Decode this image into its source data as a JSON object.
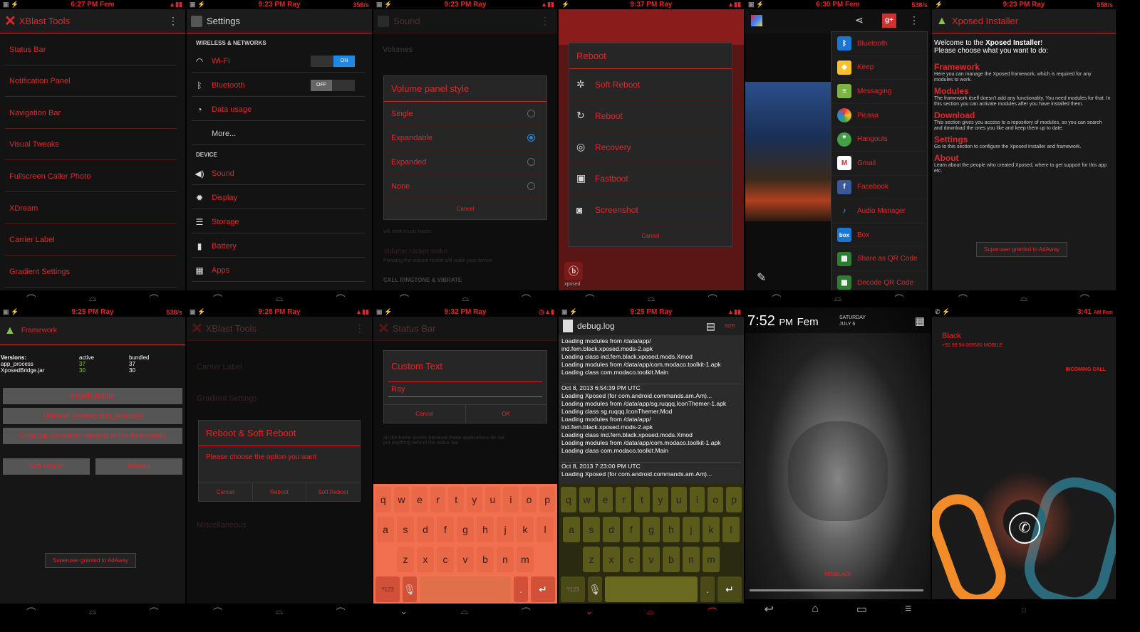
{
  "colors": {
    "accent": "#e0272b",
    "blue": "#1e88e5"
  },
  "p1": {
    "time": "6:27 PM Fem",
    "title": "XBlast Tools",
    "items": [
      "Status Bar",
      "Notification Panel",
      "Navigation Bar",
      "Visual Tweaks",
      "Fullscreen Caller Photo",
      "XDream",
      "Carrier Label",
      "Gradient Settings"
    ]
  },
  "p2": {
    "time": "9:23 PM Ray",
    "net": "358/s",
    "title": "Settings",
    "head1": "WIRELESS & NETWORKS",
    "wifi": "Wi-Fi",
    "wifi_state": "ON",
    "bt": "Bluetooth",
    "bt_state": "OFF",
    "data": "Data usage",
    "more": "More...",
    "head2": "DEVICE",
    "sound": "Sound",
    "display": "Display",
    "storage": "Storage",
    "battery": "Battery",
    "apps": "Apps"
  },
  "p3": {
    "time": "9:23 PM Ray",
    "title": "Sound",
    "bg1": "Volumes",
    "dlg_title": "Volume panel style",
    "options": [
      "Single",
      "Expandable",
      "Expanded",
      "None"
    ],
    "cancel": "Cancel",
    "bg2": "will seek music tracks",
    "bg3": "Volume rocker wake",
    "bg4": "Pressing the volume rocker will wake your device",
    "bg5": "CALL RINGTONE & VIBRATE"
  },
  "p4": {
    "time": "9:37 PM Ray",
    "title": "Reboot",
    "options": [
      "Soft Reboot",
      "Reboot",
      "Recovery",
      "Fastboot",
      "Screenshot"
    ],
    "cancel": "Cancel",
    "app": "xposed"
  },
  "p5": {
    "time": "6:30 PM Fem",
    "net": "538/s",
    "apps": [
      "Bluetooth",
      "Keep",
      "Messaging",
      "Picasa",
      "Hangouts",
      "Gmail",
      "Facebook",
      "Audio Manager",
      "Box",
      "Share as QR Code",
      "Decode QR Code"
    ]
  },
  "p6": {
    "time": "9:23 PM Ray",
    "net": "558/s",
    "title": "Xposed Installer",
    "welcome1": "Welcome to the ",
    "welcome_b": "Xposed Installer",
    "welcome2": "!",
    "welcome3": "Please choose what you want to do:",
    "sections": [
      {
        "h": "Framework",
        "p": "Here you can manage the Xposed framework, which is required for any modules to work."
      },
      {
        "h": "Modules",
        "p": "The framework itself doesn't add any functionality. You need modules for that. In this section you can activate modules after you have installed them."
      },
      {
        "h": "Download",
        "p": "This section gives you access to a repository of modules, so you can search and download the ones you like and keep them up to date."
      },
      {
        "h": "Settings",
        "p": "Go to this section to configure the Xposed Installer and framework."
      },
      {
        "h": "About",
        "p": "Learn about the people who created Xposed, where to get support for this app etc."
      }
    ],
    "toast": "Superuser granted to AdAway"
  },
  "p7": {
    "time": "9:25 PM Ray",
    "net": "538/s",
    "title": "Framework",
    "versions": "Versions:",
    "active": "active",
    "bundled": "bundled",
    "rows": [
      {
        "n": "app_process",
        "a": "37",
        "b": "37"
      },
      {
        "n": "XposedBridge.jar",
        "a": "30",
        "b": "30"
      }
    ],
    "install": "Install/Update",
    "uninstall": "Uninstall (restore app_process)",
    "cleanup": "Clean up (complete removal of the framework)",
    "soft": "Soft reboot",
    "reboot": "Reboot",
    "toast": "Superuser granted to AdAway"
  },
  "p8": {
    "time": "9:28 PM Ray",
    "title": "XBlast Tools",
    "bg1": "Carrier Label",
    "bg2": "Gradient Settings",
    "dlg_title": "Reboot & Soft Reboot",
    "msg": "Please choose the option you want",
    "btns": [
      "Cancel",
      "Reboot",
      "Soft Reboot"
    ],
    "bg3": "Miscellaneous"
  },
  "p9": {
    "time": "9:32 PM Ray",
    "title": "Status Bar",
    "dlg_title": "Custom Text",
    "value": "Ray",
    "cancel": "Cancel",
    "ok": "OK",
    "bg": "on the home screen because these applications do not put anything behind the status bar",
    "row1": [
      "q",
      "w",
      "e",
      "r",
      "t",
      "y",
      "u",
      "i",
      "o",
      "p"
    ],
    "row2": [
      "a",
      "s",
      "d",
      "f",
      "g",
      "h",
      "j",
      "k",
      "l"
    ],
    "row3": [
      "z",
      "x",
      "c",
      "v",
      "b",
      "n",
      "m"
    ],
    "sym": "?123"
  },
  "p10": {
    "time": "9:25 PM Ray",
    "title": "debug.log",
    "size": "SIZE",
    "lines": [
      "Loading modules from /data/app/",
      "ind.fem.black.xposed.mods-2.apk",
      "  Loading class ind.fem.black.xposed.mods.Xmod",
      "Loading modules from /data/app/com.modaco.toolkit-1.apk",
      "  Loading class com.modaco.toolkit.Main",
      "",
      "Oct 8, 2013 6:54:39 PM UTC",
      "Loading Xposed (for com.android.commands.am.Am)...",
      "Loading modules from /data/app/sg.ruqqq.IconThemer-1.apk",
      "  Loading class sg.ruqqq.IconThemer.Mod",
      "Loading modules from /data/app/",
      "ind.fem.black.xposed.mods-2.apk",
      "  Loading class ind.fem.black.xposed.mods.Xmod",
      "Loading modules from /data/app/com.modaco.toolkit-1.apk",
      "  Loading class com.modaco.toolkit.Main",
      "",
      "Oct 8, 2013 7:23:00 PM UTC",
      "Loading Xposed (for com.android.commands.am.Am)..."
    ]
  },
  "p11": {
    "time": "7:52",
    "ampm": "PM",
    "name": "Fem",
    "day": "SATURDAY",
    "date": "JULY 6",
    "brand": "FEMBLACK"
  },
  "p12": {
    "time": "3:41",
    "ampm": "AM Fem",
    "caller": "Black",
    "number": "+91 99 94 069580",
    "type": "MOBILE",
    "status": "INCOMING CALL"
  }
}
